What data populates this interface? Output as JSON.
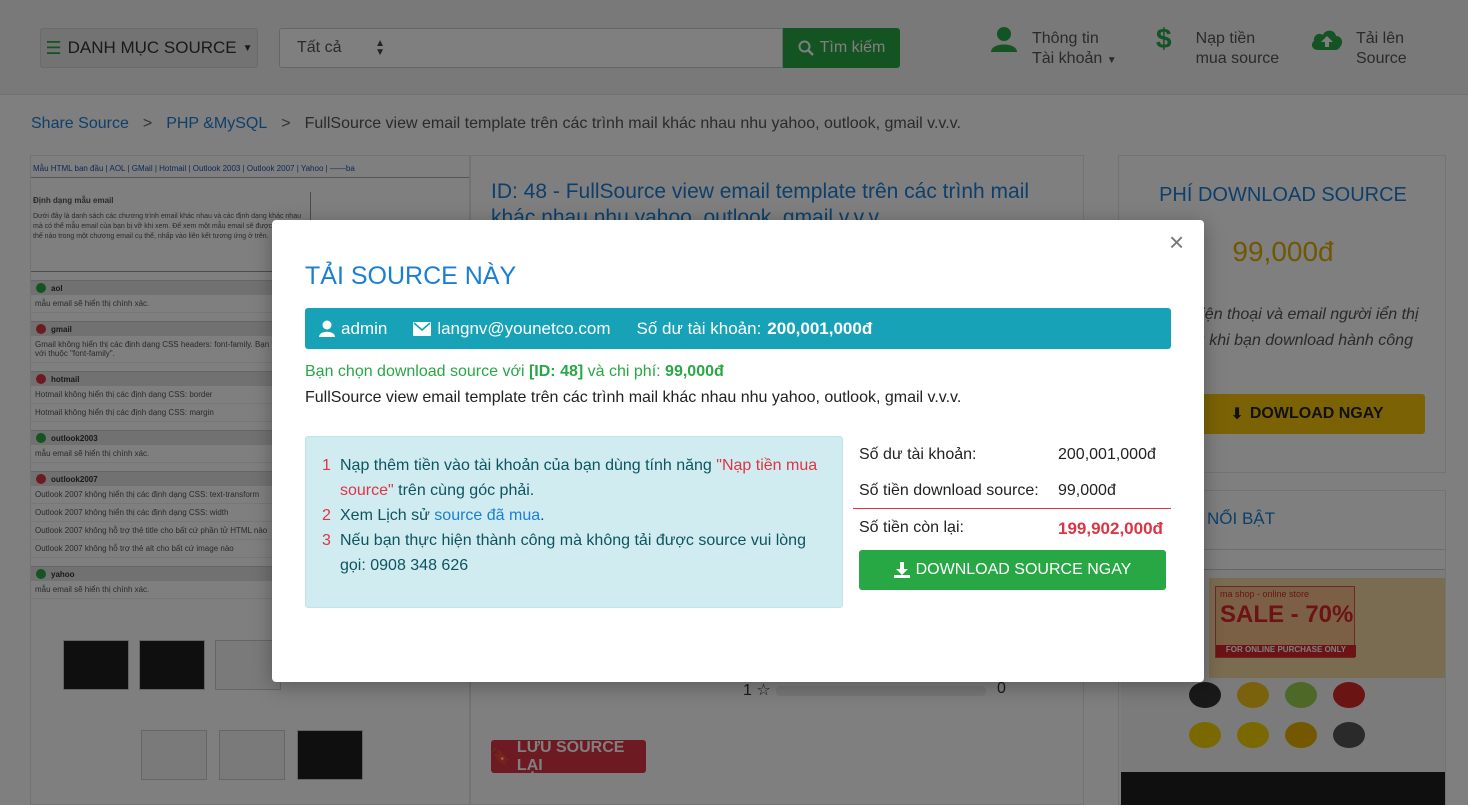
{
  "header": {
    "category_label": "DANH MỤC SOURCE",
    "search_select": "Tất cả",
    "search_placeholder": "",
    "search_button": "Tìm kiếm",
    "account_line1": "Thông tin",
    "account_line2": "Tài khoản",
    "topup_line1": "Nạp tiền",
    "topup_line2": "mua source",
    "upload_line1": "Tải lên",
    "upload_line2": "Source"
  },
  "breadcrumb": {
    "items": [
      "Share Source",
      "PHP &MySQL",
      "FullSource view email template trên các trình mail khác nhau nhu yahoo, outlook, gmail v.v.v."
    ],
    "separator": ">"
  },
  "preview": {
    "tabs": "Mẫu HTML ban đầu | AOL | GMail | Hotmail | Outlook 2003 | Outlook 2007 | Yahoo | ——ba",
    "box_title": "Định dạng mẫu email",
    "box_text": "Dưới đây là danh sách các chương trình email khác nhau và các định dạng khác nhau mà có thể mẫu email của bạn bị vỡ khi xem. Để xem một mẫu email sẽ được hiển thị thế nào trong một chương email cụ thể, nhấp vào liên kết tương ứng ở trên.",
    "rows": [
      {
        "name": "aol",
        "status": "ok",
        "lines": [
          "mẫu email sẽ hiển thị chính xác."
        ]
      },
      {
        "name": "gmail",
        "status": "error",
        "lines": [
          "Gmail không hiển thị các định dạng CSS headers: font-family. Bạn thể dùng thẻ HTML \"font face\" thay thế, hoặc kết hợp với thuộc \"font-family\"."
        ]
      },
      {
        "name": "hotmail",
        "status": "error",
        "lines": [
          "Hotmail không hiển thị các định dạng CSS: border",
          "Hotmail không hiển thị các định dạng CSS: margin"
        ]
      },
      {
        "name": "outlook2003",
        "status": "ok",
        "lines": [
          "mẫu email sẽ hiển thị chính xác."
        ]
      },
      {
        "name": "outlook2007",
        "status": "error",
        "lines": [
          "Outlook 2007 không hiển thị các định dạng CSS: text-transform",
          "Outlook 2007 không hiển thị các định dạng CSS: width",
          "Outlook 2007 không hỗ trợ thẻ title cho bất cứ phần tử HTML nào",
          "Outlook 2007 không hỗ trợ thẻ alt cho bất cứ image nào"
        ]
      },
      {
        "name": "yahoo",
        "status": "ok",
        "lines": [
          "mẫu email sẽ hiển thị chính xác."
        ]
      }
    ]
  },
  "detail": {
    "title": "ID: 48 - FullSource view email template trên các trình mail khác nhau nhu yahoo, outlook, gmail v.v.v.",
    "rating_label": "1",
    "rating_count": "0",
    "save_button": "LƯU SOURCE LẠI"
  },
  "fee_panel": {
    "title": "PHÍ DOWNLOAD SOURCE",
    "price": "99,000đ",
    "note": "ố điện thoại và email người iển thị sau khi bạn download hành công",
    "button": "DOWLOAD NGAY"
  },
  "featured": {
    "title": "NỔI BẬT",
    "shop_top": "shop",
    "sale_small": "ma shop - online store",
    "sale_text": "SALE - 70%",
    "sale_bar": "FOR ONLINE PURCHASE ONLY"
  },
  "modal": {
    "title": "TẢI SOURCE NÀY",
    "close": "×",
    "user": "admin",
    "email": "langnv@younetco.com",
    "balance_label": "Số dư tài khoản:",
    "balance_value": "200,001,000đ",
    "choice_prefix": "Bạn chọn download source với",
    "choice_id": "[ID: 48]",
    "choice_mid": "và chi phí:",
    "choice_price": "99,000đ",
    "source_name": "FullSource view email template trên các trình mail khác nhau nhu yahoo, outlook, gmail v.v.v.",
    "instructions": [
      {
        "num": "1",
        "pre": "Nạp thêm tiền vào tài khoản của bạn dùng tính năng ",
        "link": "\"Nạp tiền mua source\"",
        "post": " trên cùng góc phải."
      },
      {
        "num": "2",
        "pre": "Xem Lịch sử ",
        "link": "source đã mua",
        "post": "."
      },
      {
        "num": "3",
        "pre": "Nếu bạn thực hiện thành công mà không tải được source vui lòng gọi: 0908 348 626",
        "link": "",
        "post": ""
      }
    ],
    "summary": {
      "balance_label": "Số dư tài khoản:",
      "balance_value": "200,001,000đ",
      "cost_label": "Số tiền download source:",
      "cost_value": "99,000đ",
      "remaining_label": "Số tiền còn lại:",
      "remaining_value": "199,902,000đ"
    },
    "download_button": "DOWNLOAD SOURCE NGAY"
  },
  "colors": {
    "primary_blue": "#1a7fd4",
    "success_green": "#28a745",
    "info_teal": "#17a2b8",
    "danger_red": "#dc3545",
    "warning_yellow": "#f7c60a"
  }
}
